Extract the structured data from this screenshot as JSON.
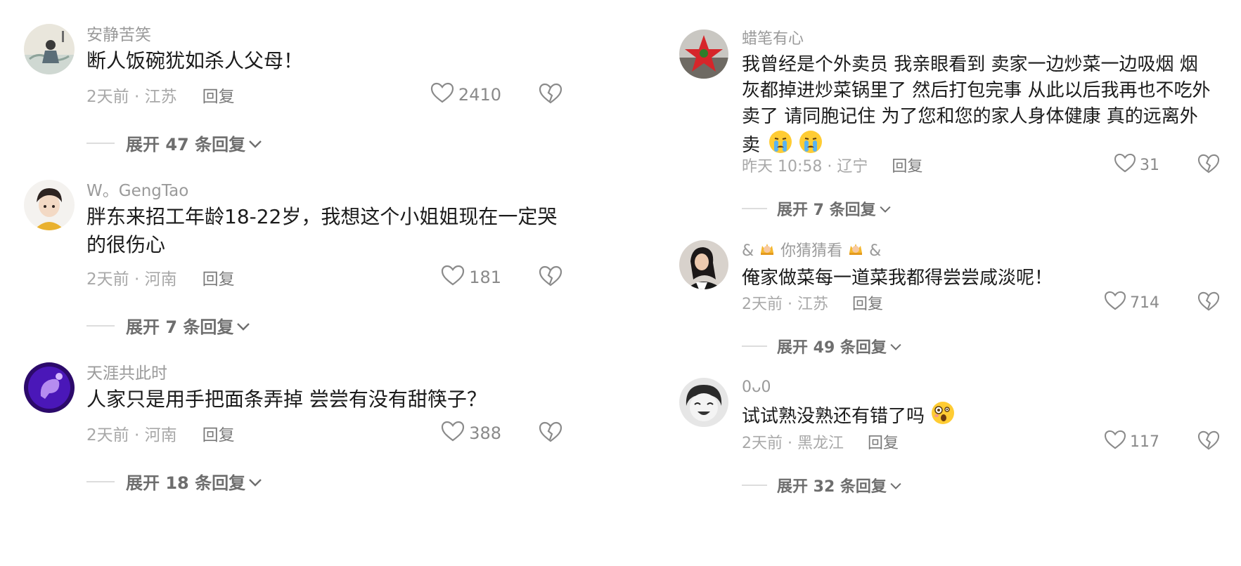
{
  "colors": {
    "text": "#1b1b1b",
    "muted": "#9a9a9a",
    "icon": "#8a8a8a"
  },
  "left_comments": [
    {
      "username": "安静苦笑",
      "text": "断人饭碗犹如杀人父母！",
      "time": "2天前 · 江苏",
      "reply": "回复",
      "likes": "2410",
      "expand": "展开 47 条回复"
    },
    {
      "username": "W。GengTao",
      "text": "胖东来招工年龄18-22岁，我想这个小姐姐现在一定哭的很伤心",
      "time": "2天前 · 河南",
      "reply": "回复",
      "likes": "181",
      "expand": "展开 7 条回复"
    },
    {
      "username": "天涯共此时",
      "text": "人家只是用手把面条弄掉 尝尝有没有甜筷子？",
      "time": "2天前 · 河南",
      "reply": "回复",
      "likes": "388",
      "expand": "展开 18 条回复"
    }
  ],
  "right_comments": [
    {
      "username": "蜡笔有心",
      "text": "我曾经是个外卖员 我亲眼看到 卖家一边炒菜一边吸烟 烟灰都掉进炒菜锅里了 然后打包完事 从此以后我再也不吃外卖了  请同胞记住 为了您和您的家人身体健康 真的远离外卖",
      "emoji": "crying-face-emoji x2",
      "time": "昨天 10:58 · 辽宁",
      "reply": "回复",
      "likes": "31",
      "expand": "展开 7 条回复"
    },
    {
      "username_prefix": "&",
      "username": "你猜猜看",
      "username_suffix": "&",
      "text": "俺家做菜每一道菜我都得尝尝咸淡呢！",
      "time": "2天前 · 江苏",
      "reply": "回复",
      "likes": "714",
      "expand": "展开 49 条回复"
    },
    {
      "username": "0ᴗ0",
      "text": "试试熟没熟还有错了吗",
      "emoji": "astonished-face-emoji",
      "time": "2天前 · 黑龙江",
      "reply": "回复",
      "likes": "117",
      "expand": "展开 32 条回复"
    }
  ]
}
